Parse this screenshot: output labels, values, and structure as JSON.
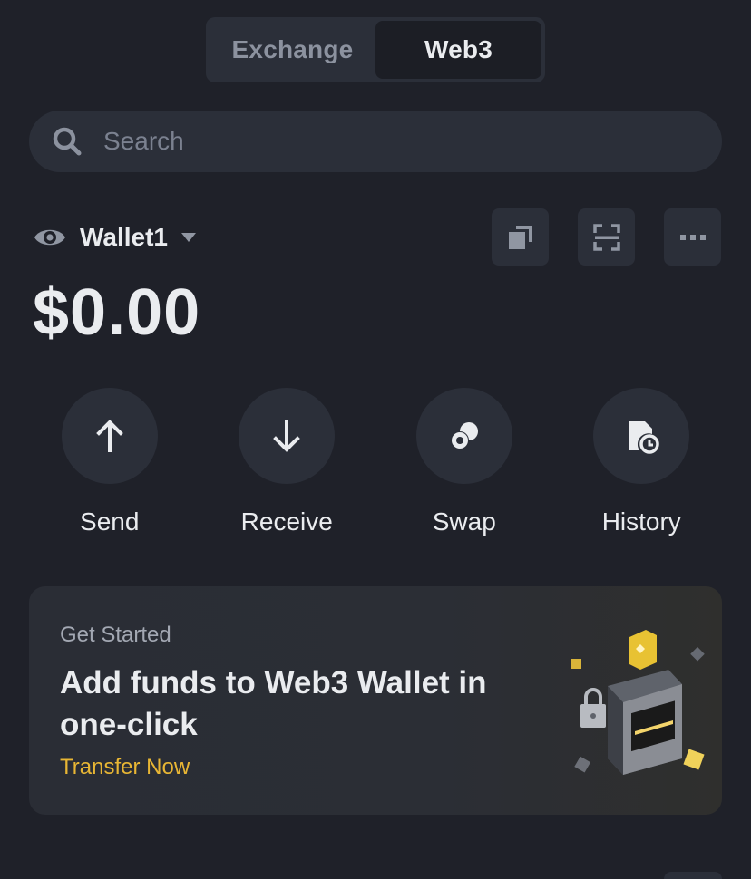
{
  "toggle": {
    "tabs": [
      {
        "label": "Exchange",
        "active": false
      },
      {
        "label": "Web3",
        "active": true
      }
    ]
  },
  "search": {
    "placeholder": "Search"
  },
  "wallet": {
    "name": "Wallet1",
    "balance": "$0.00"
  },
  "actions": [
    {
      "label": "Send",
      "icon": "arrow-up-icon"
    },
    {
      "label": "Receive",
      "icon": "arrow-down-icon"
    },
    {
      "label": "Swap",
      "icon": "swap-icon"
    },
    {
      "label": "History",
      "icon": "history-icon"
    }
  ],
  "banner": {
    "eyebrow": "Get Started",
    "title": "Add funds to Web3 Wallet in one-click",
    "link": "Transfer Now"
  },
  "colors": {
    "background": "#1f2129",
    "surface": "#2b2f39",
    "accent": "#e8b634",
    "text": "#eaecef",
    "muted": "#8c929f"
  }
}
